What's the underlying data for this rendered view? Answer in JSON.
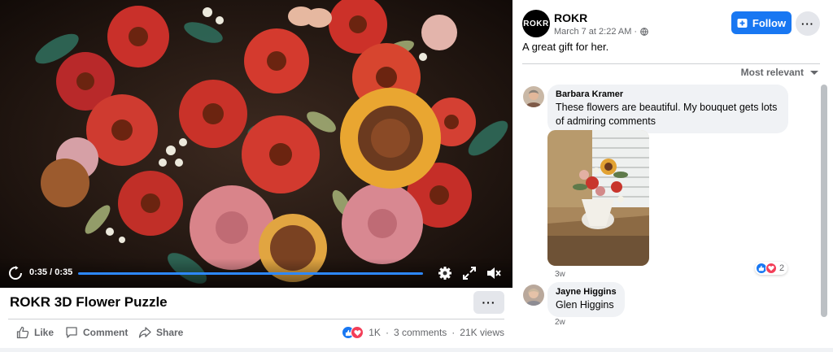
{
  "video": {
    "current_time": "0:35",
    "duration": "0:35",
    "time_separator": " / ",
    "progress_fraction": 1.0,
    "title": "ROKR 3D Flower Puzzle"
  },
  "actions": {
    "like": "Like",
    "comment": "Comment",
    "share": "Share"
  },
  "stats": {
    "reactions": "1K",
    "comments": "3 comments",
    "separator": "·",
    "views": "21K views"
  },
  "post": {
    "page_name": "ROKR",
    "avatar_text": "ROKR",
    "time": "March 7 at 2:22 AM ·",
    "follow_label": "Follow",
    "text": "A great gift for her."
  },
  "sort_label": "Most relevant",
  "comments": [
    {
      "author": "Barbara Kramer",
      "text": "These flowers are beautiful. My bouquet gets lots of admiring comments",
      "age": "3w",
      "reaction_count": "2"
    },
    {
      "author": "Jayne Higgins",
      "text": "Glen Higgins",
      "age": "2w"
    }
  ],
  "colors": {
    "accent": "#1877f2",
    "like": "#1877f2",
    "love": "#f33e58",
    "progress": "#2d88ff"
  },
  "icons": {
    "replay": "replay-icon",
    "settings": "gear-icon",
    "fullscreen": "expand-icon",
    "volume": "volume-muted-icon",
    "globe": "globe-icon",
    "like": "thumbs-up-icon",
    "comment": "speech-bubble-icon",
    "share": "share-arrow-icon"
  }
}
